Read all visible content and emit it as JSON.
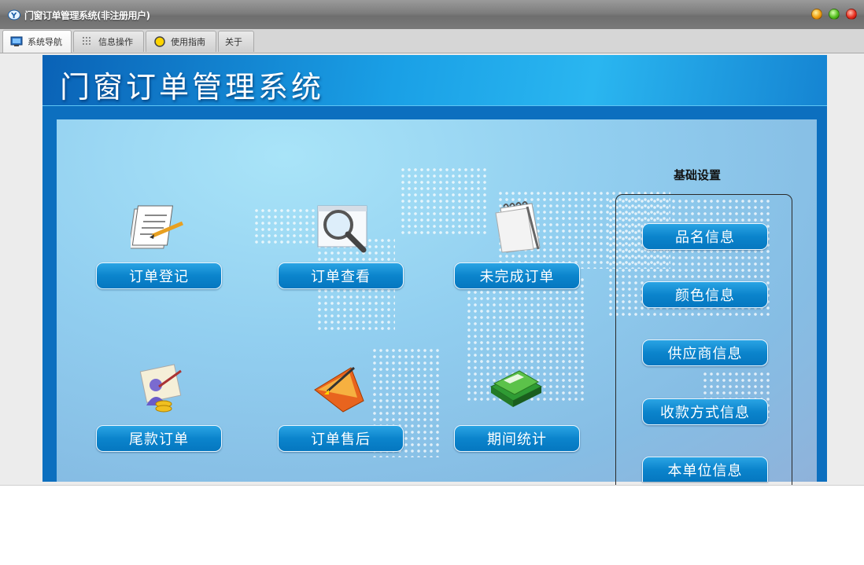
{
  "window": {
    "title": "门窗订单管理系统(非注册用户)"
  },
  "tabs": [
    {
      "label": "系统导航",
      "icon": "monitor-icon",
      "active": true
    },
    {
      "label": "信息操作",
      "icon": "grid-icon",
      "active": false
    },
    {
      "label": "使用指南",
      "icon": "guide-icon",
      "active": false
    },
    {
      "label": "关于",
      "icon": "",
      "active": false
    }
  ],
  "banner": {
    "title": "门窗订单管理系统"
  },
  "nav": {
    "order_register": "订单登记",
    "order_view": "订单查看",
    "unfinished_orders": "未完成订单",
    "balance_orders": "尾款订单",
    "after_sales": "订单售后",
    "period_stats": "期间统计"
  },
  "settings": {
    "title": "基础设置",
    "items": [
      "品名信息",
      "颜色信息",
      "供应商信息",
      "收款方式信息",
      "本单位信息"
    ]
  },
  "colors": {
    "accent": "#0b84cc",
    "banner": "#0c6fbf"
  }
}
